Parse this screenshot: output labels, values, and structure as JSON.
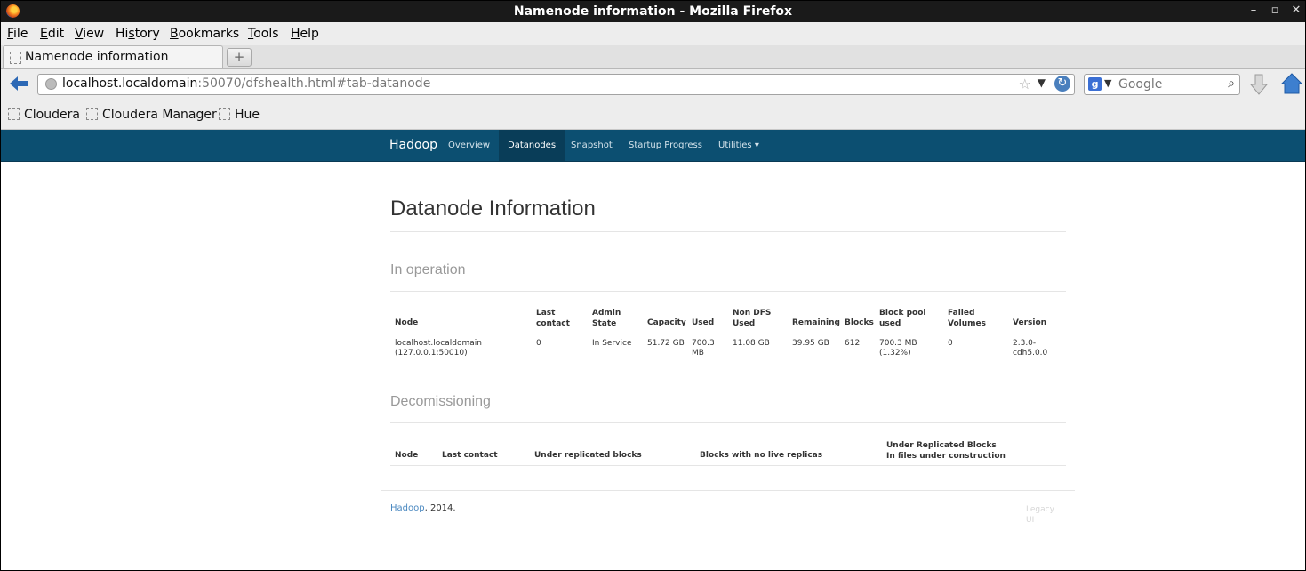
{
  "window": {
    "title": "Namenode information - Mozilla Firefox",
    "controls": [
      "–",
      "▫",
      "✕"
    ]
  },
  "menu": {
    "items": [
      {
        "label": "File",
        "accel": "F",
        "rest": "ile"
      },
      {
        "label": "Edit",
        "accel": "E",
        "rest": "dit"
      },
      {
        "label": "View",
        "accel": "V",
        "rest": "iew"
      },
      {
        "label": "History",
        "pre": "Hi",
        "accel": "s",
        "rest": "tory"
      },
      {
        "label": "Bookmarks",
        "accel": "B",
        "rest": "ookmarks"
      },
      {
        "label": "Tools",
        "accel": "T",
        "rest": "ools"
      },
      {
        "label": "Help",
        "accel": "H",
        "rest": "elp"
      }
    ]
  },
  "tab": {
    "label": "Namenode information",
    "new_tab_symbol": "+"
  },
  "address": {
    "host": "localhost.localdomain",
    "rest": ":50070/dfshealth.html#tab-datanode"
  },
  "search": {
    "placeholder": "Google",
    "engine_icon": "google-icon"
  },
  "bookmarks": [
    "Cloudera",
    "Cloudera Manager",
    "Hue"
  ],
  "hadoop_nav": {
    "brand": "Hadoop",
    "items": [
      "Overview",
      "Datanodes",
      "Snapshot",
      "Startup Progress",
      "Utilities ▾"
    ],
    "active": "Datanodes"
  },
  "page": {
    "title": "Datanode Information",
    "in_operation": {
      "heading": "In operation",
      "columns": [
        "Node",
        "Last contact",
        "Admin State",
        "Capacity",
        "Used",
        "Non DFS Used",
        "Remaining",
        "Blocks",
        "Block pool used",
        "Failed Volumes",
        "Version"
      ],
      "columns_wrapped": [
        "Node",
        "Last\ncontact",
        "Admin\nState",
        "Capacity",
        "Used",
        "Non DFS\nUsed",
        "Remaining",
        "Blocks",
        "Block pool\nused",
        "Failed\nVolumes",
        "Version"
      ],
      "rows": [
        [
          "localhost.localdomain\n(127.0.0.1:50010)",
          "0",
          "In Service",
          "51.72 GB",
          "700.3\nMB",
          "11.08 GB",
          "39.95 GB",
          "612",
          "700.3 MB\n(1.32%)",
          "0",
          "2.3.0-\ncdh5.0.0"
        ]
      ]
    },
    "decommissioning": {
      "heading": "Decomissioning",
      "columns": [
        "Node",
        "Last contact",
        "Under replicated blocks",
        "Blocks with no live replicas",
        "Under Replicated Blocks\nIn files under construction"
      ]
    },
    "footer": {
      "link": "Hadoop",
      "text": ", 2014.",
      "legacy": "Legacy UI"
    }
  }
}
